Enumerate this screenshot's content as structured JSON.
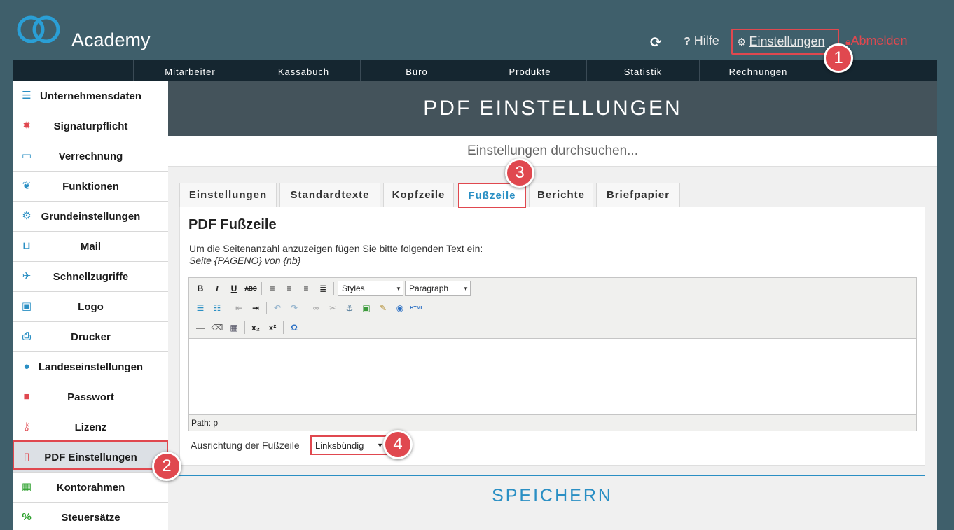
{
  "header": {
    "brand": "Academy",
    "refresh_icon": "refresh-icon",
    "help_prefix": "?",
    "help_label": "Hilfe",
    "settings_label": "Einstellungen",
    "logout_label": "Abmelden"
  },
  "nav": {
    "items": [
      "Mitarbeiter",
      "Kassabuch",
      "Büro",
      "Produkte",
      "Statistik",
      "Rechnungen"
    ]
  },
  "sidebar": {
    "items": [
      {
        "label": "Unternehmensdaten",
        "icon": "database-icon",
        "color": "#2a8fc4"
      },
      {
        "label": "Signaturpflicht",
        "icon": "seal-icon",
        "color": "#e0484f"
      },
      {
        "label": "Verrechnung",
        "icon": "credit-card-icon",
        "color": "#2a8fc4"
      },
      {
        "label": "Funktionen",
        "icon": "leaf-icon",
        "color": "#2a8fc4"
      },
      {
        "label": "Grundeinstellungen",
        "icon": "gears-icon",
        "color": "#2a8fc4"
      },
      {
        "label": "Mail",
        "icon": "inbox-icon",
        "color": "#2a8fc4"
      },
      {
        "label": "Schnellzugriffe",
        "icon": "plane-icon",
        "color": "#2a8fc4"
      },
      {
        "label": "Logo",
        "icon": "image-icon",
        "color": "#2a8fc4"
      },
      {
        "label": "Drucker",
        "icon": "printer-icon",
        "color": "#2a8fc4"
      },
      {
        "label": "Landeseinstellungen",
        "icon": "globe-icon",
        "color": "#2a8fc4"
      },
      {
        "label": "Passwort",
        "icon": "lock-icon",
        "color": "#e0484f"
      },
      {
        "label": "Lizenz",
        "icon": "key-icon",
        "color": "#e0484f"
      },
      {
        "label": "PDF Einstellungen",
        "icon": "pdf-file-icon",
        "color": "#e0484f"
      },
      {
        "label": "Kontorahmen",
        "icon": "table-icon",
        "color": "#2ca02c"
      },
      {
        "label": "Steuersätze",
        "icon": "percent-icon",
        "color": "#2ca02c"
      }
    ]
  },
  "main": {
    "title": "PDF EINSTELLUNGEN",
    "search_placeholder": "Einstellungen durchsuchen...",
    "tabs": [
      "Einstellungen",
      "Standardtexte",
      "Kopfzeile",
      "Fußzeile",
      "Berichte",
      "Briefpapier"
    ],
    "active_tab": "Fußzeile",
    "panel": {
      "title": "PDF Fußzeile",
      "line1": "Um die Seitenanzahl anzuzeigen fügen Sie bitte folgenden Text ein:",
      "line2": "Seite {PAGENO} von {nb}",
      "styles_select": "Styles",
      "format_select": "Paragraph",
      "path": "Path: p",
      "align_label": "Ausrichtung der Fußzeile",
      "align_value": "Linksbündig"
    },
    "save_label": "SPEICHERN"
  },
  "callouts": [
    "1",
    "2",
    "3",
    "4"
  ],
  "colors": {
    "background": "#3f5f6b",
    "accent": "#2a8fc4",
    "highlight": "#e0484f",
    "navbar": "#152630"
  }
}
